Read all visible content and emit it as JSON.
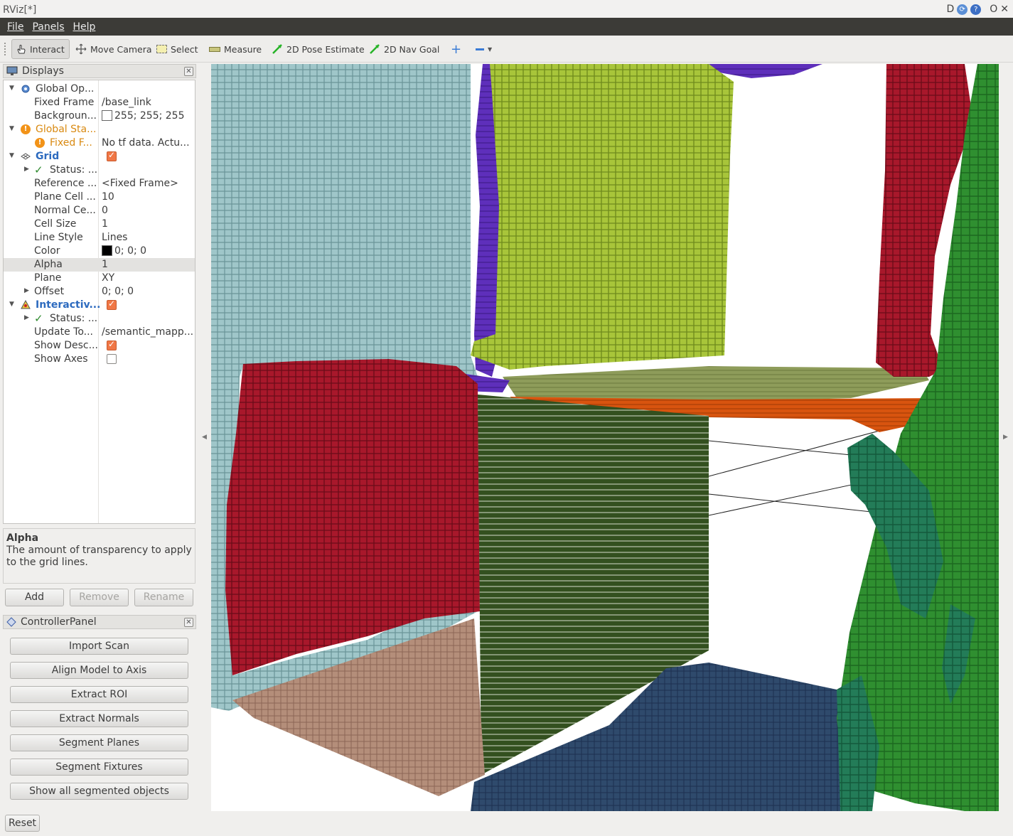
{
  "window": {
    "title": "RViz[*]",
    "controls": [
      "D",
      "O"
    ]
  },
  "menubar": {
    "items": [
      "File",
      "Panels",
      "Help"
    ]
  },
  "toolbar": {
    "tools": [
      "Interact",
      "Move Camera",
      "Select",
      "Measure",
      "2D Pose Estimate",
      "2D Nav Goal"
    ]
  },
  "displays": {
    "title": "Displays",
    "rows": [
      {
        "name": "Global Op...",
        "value": ""
      },
      {
        "name": "Fixed Frame",
        "value": "/base_link"
      },
      {
        "name": "Backgroun...",
        "value": "255; 255; 255"
      },
      {
        "name": "Global Sta...",
        "value": ""
      },
      {
        "name": "Fixed F...",
        "value": "No tf data.  Actu..."
      },
      {
        "name": "Grid",
        "value": ""
      },
      {
        "name": "Status: ...",
        "value": ""
      },
      {
        "name": "Reference ...",
        "value": "<Fixed Frame>"
      },
      {
        "name": "Plane Cell ...",
        "value": "10"
      },
      {
        "name": "Normal Ce...",
        "value": "0"
      },
      {
        "name": "Cell Size",
        "value": "1"
      },
      {
        "name": "Line Style",
        "value": "Lines"
      },
      {
        "name": "Color",
        "value": "0; 0; 0"
      },
      {
        "name": "Alpha",
        "value": "1"
      },
      {
        "name": "Plane",
        "value": "XY"
      },
      {
        "name": "Offset",
        "value": "0; 0; 0"
      },
      {
        "name": "Interactiv...",
        "value": ""
      },
      {
        "name": "Status: ...",
        "value": ""
      },
      {
        "name": "Update To...",
        "value": "/semantic_mapp..."
      },
      {
        "name": "Show Desc...",
        "value": ""
      },
      {
        "name": "Show Axes",
        "value": ""
      }
    ],
    "colors": {
      "background_swatch": "#ffffff",
      "grid_color_swatch": "#000000",
      "checkbox_on": "#f07746",
      "warning": "#d98a12",
      "link_blue": "#2d6bbf"
    }
  },
  "description": {
    "heading": "Alpha",
    "text": "The amount of transparency to apply to the grid lines."
  },
  "display_buttons": {
    "add": "Add",
    "remove": "Remove",
    "rename": "Rename"
  },
  "controller_panel": {
    "title": "ControllerPanel",
    "buttons": [
      "Import Scan",
      "Align Model to Axis",
      "Extract ROI",
      "Extract Normals",
      "Segment Planes",
      "Segment Fixtures",
      "Show all segmented objects"
    ]
  },
  "statusbar": {
    "reset": "Reset"
  },
  "viewport": {
    "segment_colors": [
      "#9cc3c6",
      "#a6c437",
      "#a3182a",
      "#5c2db8",
      "#8a9a58",
      "#d6520f",
      "#2d471d",
      "#b28b78",
      "#2c4769",
      "#2e8b2f",
      "#227a56"
    ]
  }
}
